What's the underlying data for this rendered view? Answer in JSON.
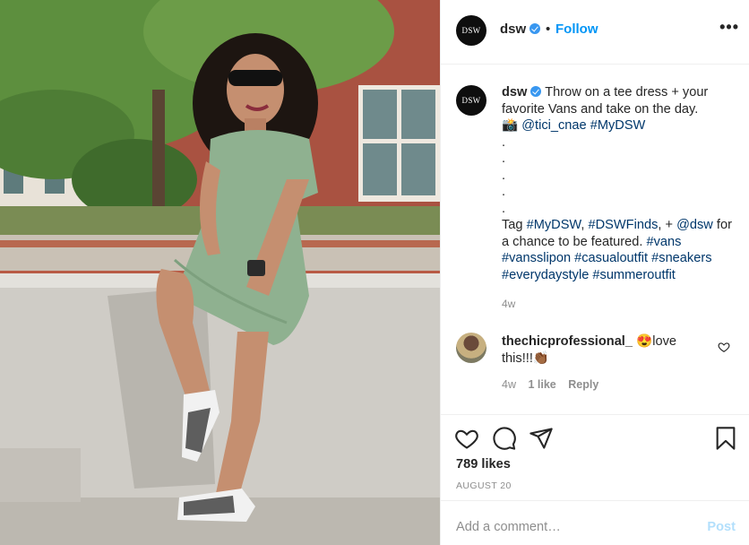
{
  "post": {
    "username": "dsw",
    "avatar_text": "DSW",
    "dot": "•",
    "follow_label": "Follow",
    "more_label": "•••",
    "caption": {
      "line1": "Throw on a tee dress + your favorite Vans and take on the day.",
      "camera": "📸",
      "mention": "@tici_cnae",
      "tag1": "#MyDSW",
      "dots": [
        ".",
        ".",
        ".",
        ".",
        "."
      ],
      "tag_text_a": "Tag",
      "tag_a": "#MyDSW",
      "tag_b": "#DSWFinds",
      "tag_text_b": ", +",
      "tag_c": "@dsw",
      "tag_text_c": "for a chance to be featured.",
      "hashtags": [
        "#vans",
        "#vansslipon",
        "#casualoutfit",
        "#sneakers",
        "#everydaystyle",
        "#summeroutfit"
      ]
    },
    "caption_time": "4w"
  },
  "comment": {
    "username": "thechicprofessional_",
    "text": "😍love this!!!👏🏾",
    "time": "4w",
    "likes": "1 like",
    "reply_label": "Reply"
  },
  "actions": {
    "likes": "789 likes",
    "date": "AUGUST 20"
  },
  "add_comment": {
    "placeholder": "Add a comment…",
    "post_label": "Post"
  },
  "colors": {
    "accent": "#0095f6",
    "verified": "#3897f0",
    "link": "#00376b",
    "muted": "#8e8e8e",
    "post_disabled": "#b2dffc"
  },
  "icons": [
    "verified-badge-icon",
    "more-options-icon",
    "heart-icon",
    "comment-icon",
    "share-icon",
    "bookmark-icon",
    "small-heart-icon"
  ]
}
